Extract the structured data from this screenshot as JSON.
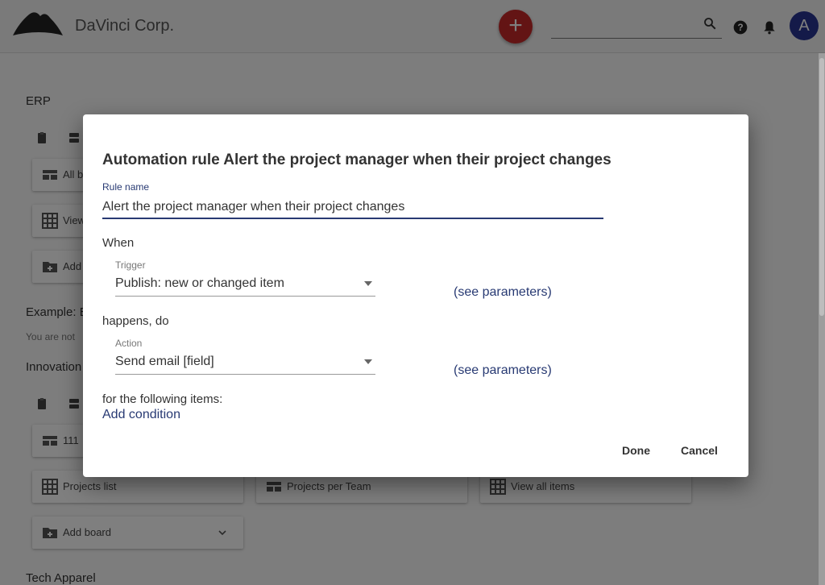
{
  "app": {
    "brand": "DaVinci Corp.",
    "avatar_letter": "A",
    "fab_label": "+"
  },
  "background": {
    "sections": [
      {
        "title": "ERP"
      },
      {
        "title": "Example: E",
        "note": "You are not"
      },
      {
        "title": "Innovation"
      },
      {
        "title": "Tech Apparel"
      }
    ],
    "erp_cards": [
      "All b",
      "View",
      "Add"
    ],
    "innovation_cards": [
      "111",
      "Projects list",
      "Add board"
    ],
    "innovation_cards_col2": [
      "Projects per Team"
    ],
    "innovation_cards_col3": [
      "View all items"
    ]
  },
  "dialog": {
    "title": "Automation rule Alert the project manager when their project changes",
    "rule_name_label": "Rule name",
    "rule_name_value": "Alert the project manager when their project changes",
    "when_label": "When",
    "trigger_label": "Trigger",
    "trigger_value": "Publish: new or changed item",
    "see_parameters_1": "(see parameters)",
    "happens_label": "happens, do",
    "action_label": "Action",
    "action_value": "Send email [field]",
    "see_parameters_2": "(see parameters)",
    "items_label": "for the following items:",
    "add_condition": "Add condition",
    "done_label": "Done",
    "cancel_label": "Cancel"
  },
  "colors": {
    "accent": "#283a73",
    "fab": "#c62828",
    "avatar": "#283593"
  }
}
